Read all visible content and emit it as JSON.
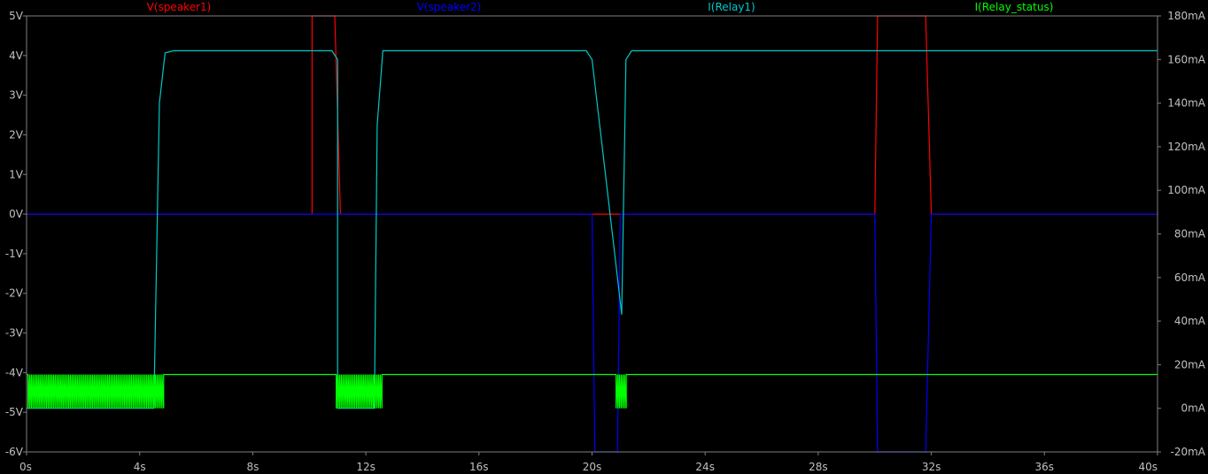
{
  "chart_data": {
    "type": "line",
    "background": "#000000",
    "frame_color": "#808080",
    "grid": true,
    "grid_color": "#808080",
    "legend_placement": "top",
    "xlim": [
      0,
      40
    ],
    "x_ticks": [
      0,
      4,
      8,
      12,
      16,
      20,
      24,
      28,
      32,
      36,
      40
    ],
    "x_tick_labels": [
      "0s",
      "4s",
      "8s",
      "12s",
      "16s",
      "20s",
      "24s",
      "28s",
      "32s",
      "36s",
      "40s"
    ],
    "y_left": {
      "unit": "V",
      "lim": [
        -6,
        5
      ],
      "ticks": [
        -6,
        -5,
        -4,
        -3,
        -2,
        -1,
        0,
        1,
        2,
        3,
        4,
        5
      ],
      "tick_labels": [
        "-6V",
        "-5V",
        "-4V",
        "-3V",
        "-2V",
        "-1V",
        "0V",
        "1V",
        "2V",
        "3V",
        "4V",
        "5V"
      ]
    },
    "y_right": {
      "unit": "mA",
      "lim": [
        -20,
        180
      ],
      "ticks": [
        -20,
        0,
        20,
        40,
        60,
        80,
        100,
        120,
        140,
        160,
        180
      ],
      "tick_labels": [
        "-20mA",
        "0mA",
        "20mA",
        "40mA",
        "60mA",
        "80mA",
        "100mA",
        "120mA",
        "140mA",
        "160mA",
        "180mA"
      ]
    },
    "series": [
      {
        "name": "V(speaker1)",
        "color": "#ff0000",
        "axis": "left",
        "x": [
          0,
          10.1,
          10.1,
          10.9,
          11.1,
          20.0,
          20.0,
          21.0,
          21.0,
          30.0,
          30.1,
          31.8,
          32.0,
          40
        ],
        "y": [
          0,
          0,
          5,
          5,
          0,
          0,
          0,
          0,
          0,
          0,
          5,
          5,
          0,
          0
        ]
      },
      {
        "name": "V(speaker2)",
        "color": "#0000ff",
        "axis": "left",
        "x": [
          0,
          20.0,
          20.1,
          20.9,
          21.0,
          30.0,
          30.1,
          31.8,
          32.0,
          40
        ],
        "y": [
          0,
          0,
          -6,
          -6,
          0,
          0,
          -6,
          -6,
          0,
          0
        ]
      },
      {
        "name": "I(Relay1)",
        "color": "#00c8c8",
        "axis": "right",
        "x": [
          0,
          4.5,
          4.7,
          4.9,
          5.2,
          10.8,
          11.0,
          11.0,
          12.3,
          12.4,
          12.6,
          19.8,
          20.0,
          20.9,
          21.05,
          21.2,
          21.4,
          40
        ],
        "y": [
          0,
          0,
          140,
          163,
          164,
          164,
          160,
          0,
          0,
          130,
          164,
          164,
          160,
          60,
          43,
          160,
          164,
          164
        ]
      },
      {
        "name": "I(Relay_status)",
        "color": "#00ff00",
        "axis": "right",
        "high": 15.5,
        "low": 0,
        "osc_bursts": [
          {
            "start": 0.05,
            "end": 4.85,
            "period": 0.06
          },
          {
            "start": 10.95,
            "end": 12.6,
            "period": 0.06
          },
          {
            "start": 20.85,
            "end": 21.25,
            "period": 0.06
          }
        ],
        "x": [
          0,
          40
        ],
        "y": [
          15.5,
          15.5
        ]
      }
    ]
  }
}
